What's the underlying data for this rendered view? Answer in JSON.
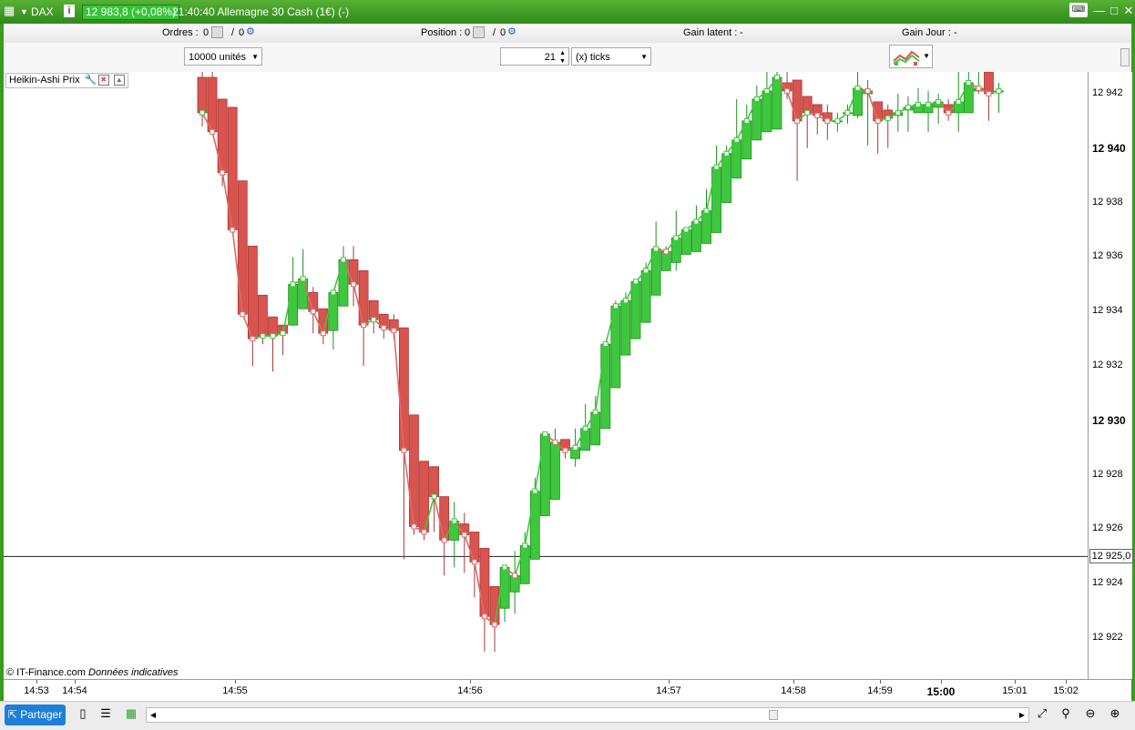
{
  "window": {
    "symbol": "DAX",
    "info_icon": "i",
    "price_badge": "12 983,8 (+0,08%)",
    "title_text": "21:40:40 Allemagne 30 Cash (1€) (-)"
  },
  "infobar": {
    "orders_label": "Ordres :",
    "orders_value_1": "0",
    "orders_value_2": "0",
    "position_label": "Position :",
    "position_value_1": "0",
    "position_value_2": "0",
    "unrealized_label": "Gain latent :",
    "unrealized_value": "-",
    "day_gain_label": "Gain Jour :",
    "day_gain_value": "-"
  },
  "controls": {
    "units_select": "10000 unités",
    "ticks_value": "21",
    "ticks_unit_select": "(x) ticks"
  },
  "indicator_label": "Heikin-Ashi Prix",
  "footnote_source": "© IT-Finance.com",
  "footnote_note": "Données indicatives",
  "current_price_label": "12 925,0",
  "toolbar": {
    "share_label": "Partager"
  },
  "colors": {
    "bull": "#3ec83e",
    "bear": "#d9534f",
    "frame_green": "#3a9a22"
  },
  "chart_data": {
    "type": "candlestick",
    "y_ticks": [
      "12 942",
      "12 940",
      "12 938",
      "12 936",
      "12 934",
      "12 932",
      "12 930",
      "12 928",
      "12 926",
      "12 924",
      "12 922"
    ],
    "y_ticks_bold": [
      "12 940",
      "12 930"
    ],
    "ylim": [
      12920.5,
      12942.8
    ],
    "x_ticks": [
      {
        "label": "14:53",
        "bold": false
      },
      {
        "label": "14:54",
        "bold": false
      },
      {
        "label": "14:55",
        "bold": false
      },
      {
        "label": "14:56",
        "bold": false
      },
      {
        "label": "14:57",
        "bold": false
      },
      {
        "label": "14:58",
        "bold": false
      },
      {
        "label": "14:59",
        "bold": false
      },
      {
        "label": "15:00",
        "bold": true
      },
      {
        "label": "15:01",
        "bold": false
      },
      {
        "label": "15:02",
        "bold": false
      }
    ],
    "current_price": 12925.0,
    "candles": [
      {
        "o": 12942.6,
        "c": 12941.3,
        "h": 12942.8,
        "l": 12940.8
      },
      {
        "o": 12942.6,
        "c": 12940.6,
        "h": 12942.8,
        "l": 12940.8
      },
      {
        "o": 12941.8,
        "c": 12939.1,
        "h": 12941.8,
        "l": 12938.6
      },
      {
        "o": 12941.5,
        "c": 12937.0,
        "h": 12941.5,
        "l": 12937.0
      },
      {
        "o": 12938.8,
        "c": 12933.9,
        "h": 12938.8,
        "l": 12933.9
      },
      {
        "o": 12936.4,
        "c": 12933.0,
        "h": 12936.4,
        "l": 12932.0
      },
      {
        "o": 12934.6,
        "c": 12933.1,
        "h": 12934.6,
        "l": 12932.8
      },
      {
        "o": 12933.8,
        "c": 12933.1,
        "h": 12933.8,
        "l": 12931.8
      },
      {
        "o": 12933.5,
        "c": 12933.2,
        "h": 12933.5,
        "l": 12932.4
      },
      {
        "o": 12933.5,
        "c": 12935.0,
        "h": 12936.0,
        "l": 12933.5
      },
      {
        "o": 12934.1,
        "c": 12935.2,
        "h": 12936.3,
        "l": 12934.1
      },
      {
        "o": 12934.7,
        "c": 12934.0,
        "h": 12934.9,
        "l": 12933.2
      },
      {
        "o": 12934.1,
        "c": 12933.2,
        "h": 12934.1,
        "l": 12932.8
      },
      {
        "o": 12933.3,
        "c": 12934.7,
        "h": 12934.7,
        "l": 12932.6
      },
      {
        "o": 12934.2,
        "c": 12935.9,
        "h": 12936.4,
        "l": 12934.2
      },
      {
        "o": 12935.9,
        "c": 12935.0,
        "h": 12936.4,
        "l": 12934.2
      },
      {
        "o": 12935.5,
        "c": 12933.5,
        "h": 12935.5,
        "l": 12932.0
      },
      {
        "o": 12934.4,
        "c": 12933.7,
        "h": 12934.4,
        "l": 12933.2
      },
      {
        "o": 12933.9,
        "c": 12933.4,
        "h": 12933.9,
        "l": 12933.0
      },
      {
        "o": 12933.7,
        "c": 12933.3,
        "h": 12933.9,
        "l": 12933.0
      },
      {
        "o": 12933.4,
        "c": 12928.9,
        "h": 12933.4,
        "l": 12924.9
      },
      {
        "o": 12930.2,
        "c": 12926.1,
        "h": 12930.2,
        "l": 12925.8
      },
      {
        "o": 12928.5,
        "c": 12925.9,
        "h": 12928.5,
        "l": 12925.6
      },
      {
        "o": 12928.3,
        "c": 12927.2,
        "h": 12928.3,
        "l": 12925.9
      },
      {
        "o": 12927.2,
        "c": 12925.6,
        "h": 12927.2,
        "l": 12924.3
      },
      {
        "o": 12925.6,
        "c": 12926.3,
        "h": 12927.0,
        "l": 12924.6
      },
      {
        "o": 12926.2,
        "c": 12925.8,
        "h": 12926.6,
        "l": 12924.4
      },
      {
        "o": 12925.9,
        "c": 12924.8,
        "h": 12925.9,
        "l": 12923.5
      },
      {
        "o": 12925.3,
        "c": 12922.8,
        "h": 12925.3,
        "l": 12921.5
      },
      {
        "o": 12923.9,
        "c": 12922.5,
        "h": 12923.9,
        "l": 12921.5
      },
      {
        "o": 12923.1,
        "c": 12924.6,
        "h": 12924.6,
        "l": 12922.6
      },
      {
        "o": 12923.7,
        "c": 12924.3,
        "h": 12925.2,
        "l": 12922.9
      },
      {
        "o": 12924.0,
        "c": 12925.4,
        "h": 12925.9,
        "l": 12924.0
      },
      {
        "o": 12924.9,
        "c": 12927.4,
        "h": 12927.9,
        "l": 12924.9
      },
      {
        "o": 12926.5,
        "c": 12929.5,
        "h": 12929.5,
        "l": 12926.5
      },
      {
        "o": 12927.1,
        "c": 12929.2,
        "h": 12929.7,
        "l": 12927.1
      },
      {
        "o": 12929.3,
        "c": 12928.9,
        "h": 12929.3,
        "l": 12928.6
      },
      {
        "o": 12928.6,
        "c": 12929.0,
        "h": 12929.7,
        "l": 12928.3
      },
      {
        "o": 12928.9,
        "c": 12929.7,
        "h": 12930.6,
        "l": 12928.9
      },
      {
        "o": 12929.1,
        "c": 12930.3,
        "h": 12930.9,
        "l": 12929.1
      },
      {
        "o": 12929.7,
        "c": 12932.8,
        "h": 12932.8,
        "l": 12929.7
      },
      {
        "o": 12931.2,
        "c": 12934.2,
        "h": 12934.4,
        "l": 12931.2
      },
      {
        "o": 12932.4,
        "c": 12934.4,
        "h": 12934.7,
        "l": 12932.4
      },
      {
        "o": 12933.0,
        "c": 12935.1,
        "h": 12935.1,
        "l": 12933.0
      },
      {
        "o": 12933.6,
        "c": 12935.5,
        "h": 12935.8,
        "l": 12933.6
      },
      {
        "o": 12934.6,
        "c": 12936.3,
        "h": 12937.3,
        "l": 12934.6
      },
      {
        "o": 12935.5,
        "c": 12936.2,
        "h": 12936.4,
        "l": 12935.5
      },
      {
        "o": 12935.8,
        "c": 12936.7,
        "h": 12937.7,
        "l": 12935.5
      },
      {
        "o": 12936.1,
        "c": 12937.0,
        "h": 12937.0,
        "l": 12936.1
      },
      {
        "o": 12936.2,
        "c": 12937.3,
        "h": 12937.9,
        "l": 12936.2
      },
      {
        "o": 12936.5,
        "c": 12937.7,
        "h": 12938.5,
        "l": 12936.5
      },
      {
        "o": 12936.9,
        "c": 12939.3,
        "h": 12940.1,
        "l": 12936.9
      },
      {
        "o": 12938.0,
        "c": 12939.8,
        "h": 12940.1,
        "l": 12938.0
      },
      {
        "o": 12938.9,
        "c": 12940.3,
        "h": 12941.8,
        "l": 12938.9
      },
      {
        "o": 12939.6,
        "c": 12941.0,
        "h": 12941.6,
        "l": 12939.6
      },
      {
        "o": 12940.3,
        "c": 12941.8,
        "h": 12942.3,
        "l": 12940.3
      },
      {
        "o": 12940.6,
        "c": 12942.1,
        "h": 12942.8,
        "l": 12940.6
      },
      {
        "o": 12940.7,
        "c": 12942.6,
        "h": 12942.8,
        "l": 12940.7
      },
      {
        "o": 12942.4,
        "c": 12942.1,
        "h": 12942.8,
        "l": 12941.8
      },
      {
        "o": 12942.5,
        "c": 12941.0,
        "h": 12942.5,
        "l": 12938.8
      },
      {
        "o": 12941.9,
        "c": 12941.3,
        "h": 12941.9,
        "l": 12940.0
      },
      {
        "o": 12941.6,
        "c": 12941.2,
        "h": 12941.6,
        "l": 12940.5
      },
      {
        "o": 12941.3,
        "c": 12941.0,
        "h": 12941.6,
        "l": 12940.3
      },
      {
        "o": 12941.0,
        "c": 12941.0,
        "h": 12941.3,
        "l": 12940.6
      },
      {
        "o": 12941.3,
        "c": 12941.3,
        "h": 12941.6,
        "l": 12940.9
      },
      {
        "o": 12941.2,
        "c": 12942.2,
        "h": 12942.8,
        "l": 12941.1
      },
      {
        "o": 12942.0,
        "c": 12942.1,
        "h": 12942.5,
        "l": 12940.1
      },
      {
        "o": 12941.7,
        "c": 12941.0,
        "h": 12941.7,
        "l": 12939.8
      },
      {
        "o": 12941.4,
        "c": 12941.1,
        "h": 12941.6,
        "l": 12940.0
      },
      {
        "o": 12941.2,
        "c": 12941.3,
        "h": 12942.0,
        "l": 12940.6
      },
      {
        "o": 12941.4,
        "c": 12941.5,
        "h": 12941.9,
        "l": 12940.6
      },
      {
        "o": 12941.3,
        "c": 12941.6,
        "h": 12942.2,
        "l": 12941.3
      },
      {
        "o": 12941.3,
        "c": 12941.6,
        "h": 12942.1,
        "l": 12940.6
      },
      {
        "o": 12941.5,
        "c": 12941.7,
        "h": 12942.0,
        "l": 12940.9
      },
      {
        "o": 12941.6,
        "c": 12941.3,
        "h": 12941.8,
        "l": 12941.0
      },
      {
        "o": 12941.3,
        "c": 12941.7,
        "h": 12942.8,
        "l": 12940.6
      },
      {
        "o": 12941.3,
        "c": 12942.4,
        "h": 12942.8,
        "l": 12941.3
      },
      {
        "o": 12942.1,
        "c": 12942.2,
        "h": 12942.8,
        "l": 12942.0
      },
      {
        "o": 12942.8,
        "c": 12942.0,
        "h": 12942.8,
        "l": 12941.0
      },
      {
        "o": 12942.1,
        "c": 12942.1,
        "h": 12942.4,
        "l": 12941.3
      }
    ]
  }
}
